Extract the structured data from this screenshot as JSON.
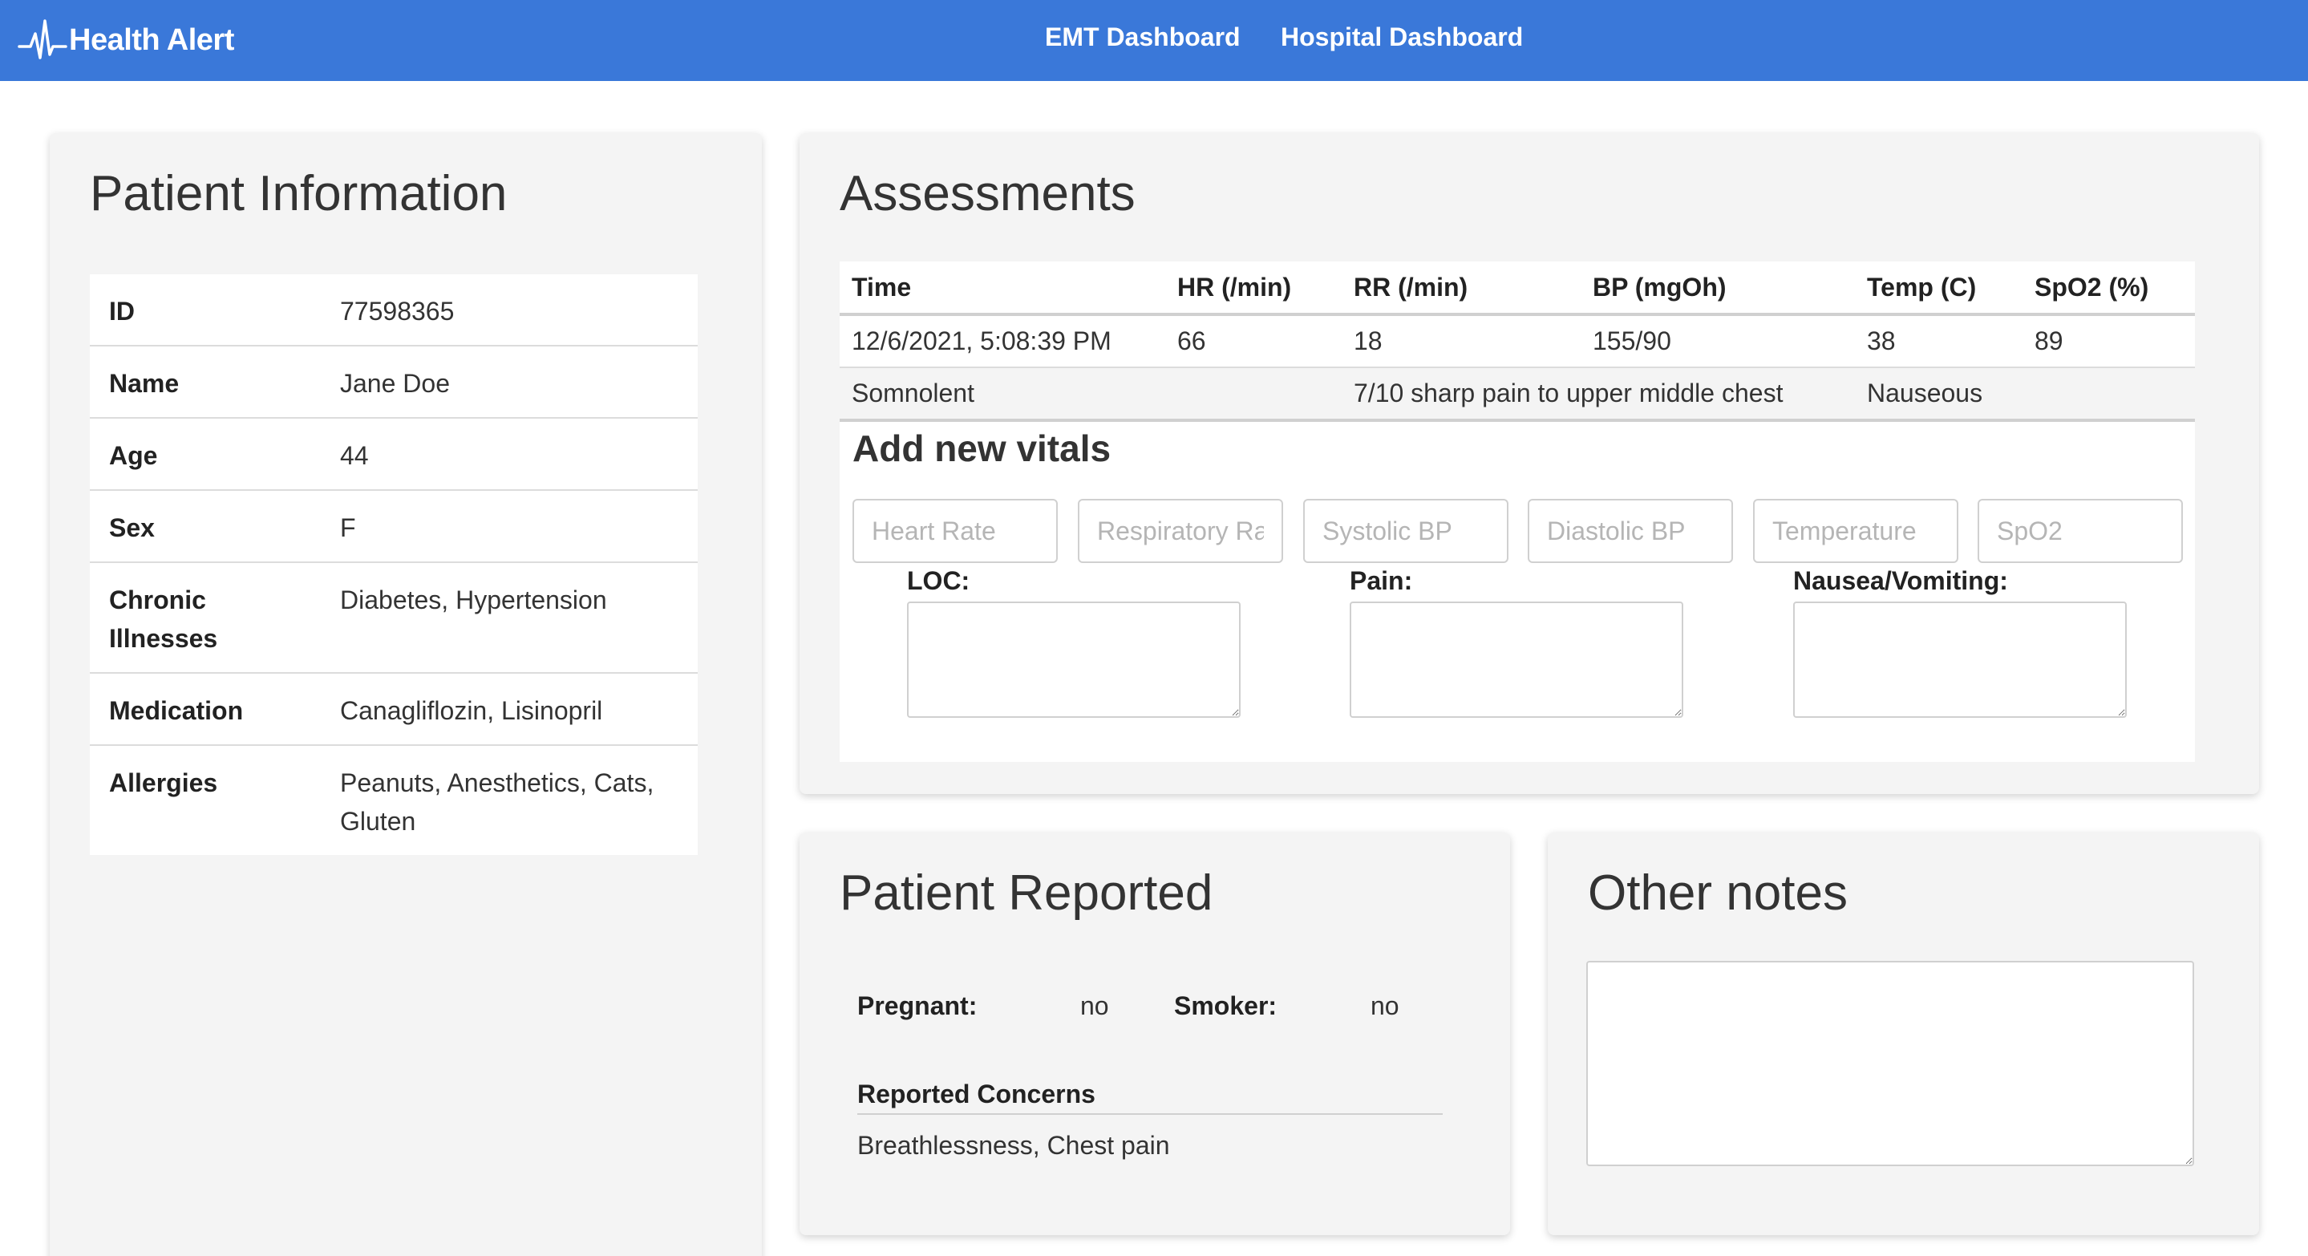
{
  "nav": {
    "brand": "Health Alert",
    "brand_icon": "heartbeat-icon",
    "links": [
      "EMT Dashboard",
      "Hospital Dashboard"
    ]
  },
  "patient": {
    "title": "Patient Information",
    "rows": [
      {
        "label": "ID",
        "value": "77598365"
      },
      {
        "label": "Name",
        "value": "Jane Doe"
      },
      {
        "label": "Age",
        "value": "44"
      },
      {
        "label": "Sex",
        "value": "F"
      },
      {
        "label": "Chronic Illnesses",
        "value": "Diabetes, Hypertension"
      },
      {
        "label": "Medication",
        "value": "Canagliflozin, Lisinopril"
      },
      {
        "label": "Allergies",
        "value": "Peanuts, Anesthetics, Cats, Gluten"
      }
    ]
  },
  "assessments": {
    "title": "Assessments",
    "columns": [
      "Time",
      "HR (/min)",
      "RR (/min)",
      "BP (mgOh)",
      "Temp (C)",
      "SpO2 (%)"
    ],
    "rows": [
      {
        "time": "12/6/2021, 5:08:39 PM",
        "hr": "66",
        "rr": "18",
        "bp": "155/90",
        "temp": "38",
        "spo2": "89"
      }
    ],
    "notes": {
      "loc": "Somnolent",
      "pain": "7/10 sharp pain to upper middle chest",
      "nausea": "Nauseous"
    },
    "add_title": "Add new vitals",
    "placeholders": [
      "Heart Rate",
      "Respiratory Rate",
      "Systolic BP",
      "Diastolic BP",
      "Temperature",
      "SpO2"
    ],
    "fields": [
      "LOC:",
      "Pain:",
      "Nausea/Vomiting:"
    ]
  },
  "reported": {
    "title": "Patient Reported",
    "pregnant_label": "Pregnant:",
    "pregnant_value": "no",
    "smoker_label": "Smoker:",
    "smoker_value": "no",
    "concerns_label": "Reported Concerns",
    "concerns_value": "Breathlessness, Chest pain"
  },
  "notes": {
    "title": "Other notes",
    "value": ""
  },
  "colors": {
    "navbar": "#3a78d9",
    "card_bg": "#f4f4f4"
  }
}
